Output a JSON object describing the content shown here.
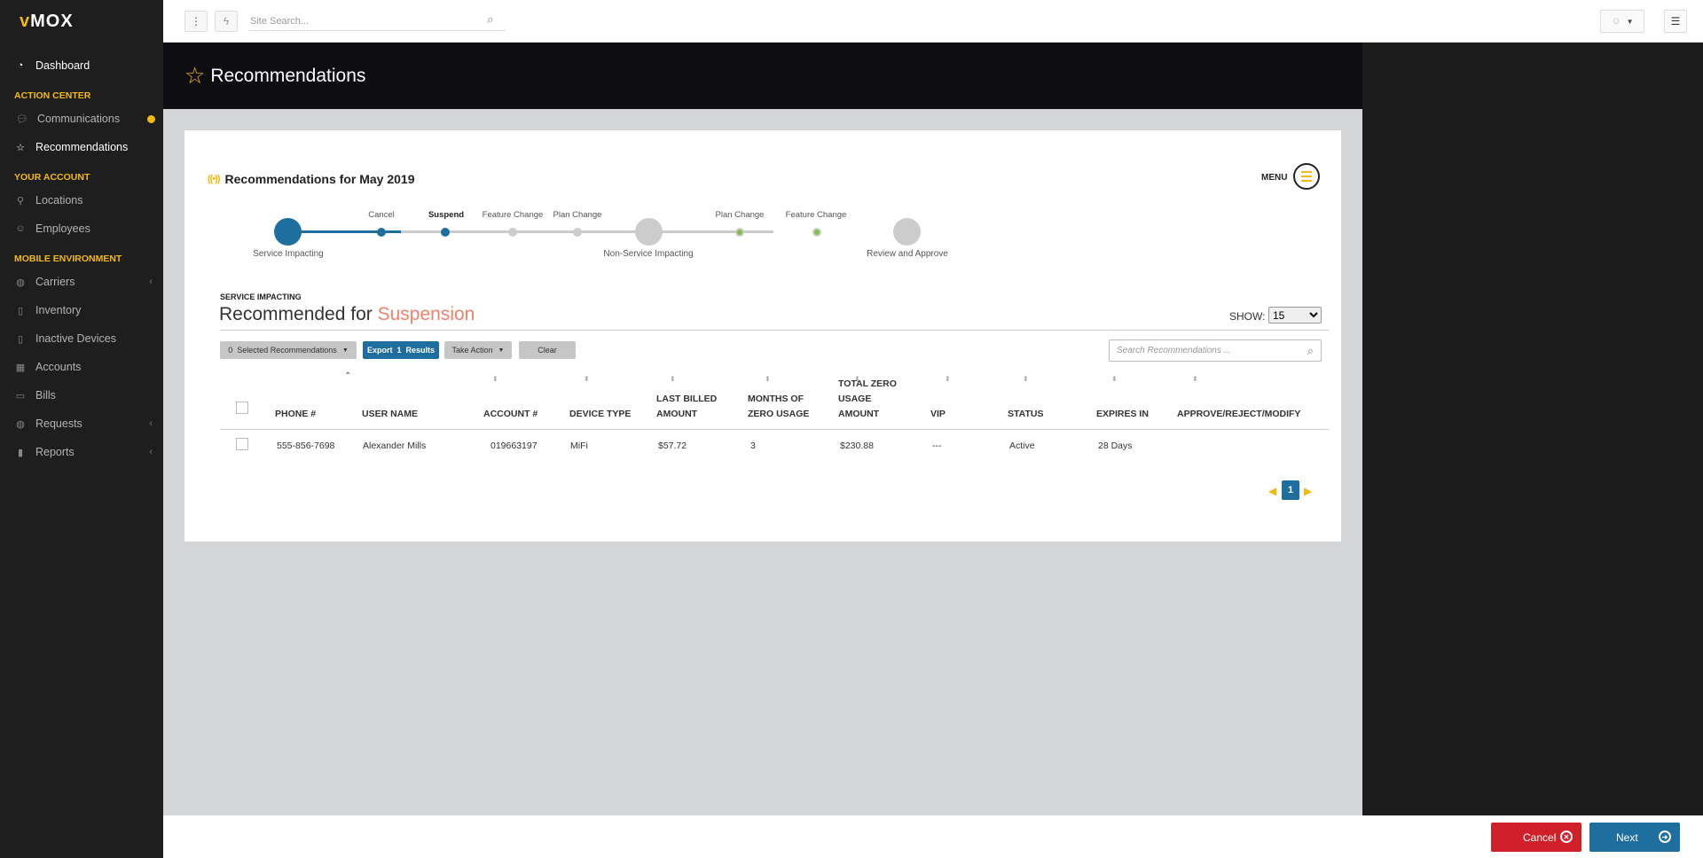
{
  "app": {
    "logo_v": "v",
    "logo_rest": "MOX"
  },
  "sidebar": {
    "dashboard": "Dashboard",
    "sections": {
      "action_center": "ACTION CENTER",
      "your_account": "YOUR ACCOUNT",
      "mobile_env": "MOBILE ENVIRONMENT"
    },
    "items": {
      "communications": "Communications",
      "recommendations": "Recommendations",
      "locations": "Locations",
      "employees": "Employees",
      "carriers": "Carriers",
      "inventory": "Inventory",
      "inactive_devices": "Inactive Devices",
      "accounts": "Accounts",
      "bills": "Bills",
      "requests": "Requests",
      "reports": "Reports"
    }
  },
  "topbar": {
    "search_placeholder": "Site Search..."
  },
  "header": {
    "title": "Recommendations"
  },
  "card": {
    "title": "Recommendations for May 2019",
    "menu_label": "MENU"
  },
  "stepper": {
    "groups": {
      "service_impacting": "Service Impacting",
      "non_service_impacting": "Non-Service Impacting",
      "review": "Review and Approve"
    },
    "substeps": {
      "cancel": "Cancel",
      "suspend": "Suspend",
      "feature_change_1": "Feature Change",
      "plan_change_1": "Plan Change",
      "plan_change_2": "Plan Change",
      "feature_change_2": "Feature Change"
    }
  },
  "section": {
    "subtitle": "SERVICE IMPACTING",
    "title_prefix": "Recommended for ",
    "title_highlight": "Suspension",
    "show_label": "SHOW:",
    "show_value": "15"
  },
  "toolbar": {
    "selected": "0  Selected Recommendations",
    "export": "Export  1  Results",
    "take_action": "Take Action",
    "clear": "Clear",
    "search_placeholder": "Search Recommendations ..."
  },
  "table": {
    "headers": {
      "phone": "PHONE #",
      "user_name": "USER NAME",
      "account": "ACCOUNT #",
      "device_type": "DEVICE TYPE",
      "last_billed_1": "LAST BILLED",
      "last_billed_2": "AMOUNT",
      "months_1": "MONTHS OF",
      "months_2": "ZERO USAGE",
      "total_1": "TOTAL ZERO",
      "total_2": "USAGE",
      "total_3": "AMOUNT",
      "vip": "VIP",
      "status": "STATUS",
      "expires": "EXPIRES IN",
      "approve": "APPROVE/REJECT/MODIFY"
    },
    "rows": [
      {
        "phone": "555-856-7698",
        "user_name": "Alexander Mills",
        "account": "019663197",
        "device_type": "MiFi",
        "last_billed": "$57.72",
        "months_zero": "3",
        "total_zero": "$230.88",
        "vip": "---",
        "status": "Active",
        "expires": "28 Days"
      }
    ]
  },
  "pagination": {
    "current": "1"
  },
  "footer": {
    "cancel": "Cancel",
    "next": "Next"
  },
  "colors": {
    "accent": "#f2b90f",
    "primary_blue": "#1f6ea0",
    "danger": "#d0212a",
    "highlight": "#f0816b",
    "success": "#7cc242"
  }
}
